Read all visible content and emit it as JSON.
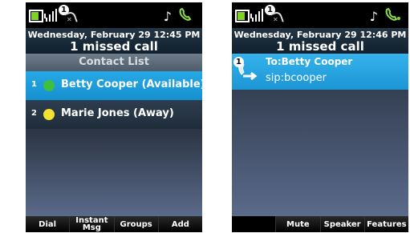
{
  "status_bar": {
    "notification_count": "1",
    "icons": [
      "battery-icon",
      "signal-icon",
      "missed-call-icon",
      "music-note-icon",
      "handset-icon"
    ]
  },
  "left_screen": {
    "date_line": "Wednesday, February 29 12:45 PM",
    "missed_line": "1 missed call",
    "list_title": "Contact List",
    "contacts": [
      {
        "index": "1",
        "name": "Betty Cooper (Available)",
        "status_color": "#3fbf3f"
      },
      {
        "index": "2",
        "name": "Marie Jones (Away)",
        "status_color": "#f2e033"
      }
    ],
    "softkeys": [
      "Dial",
      "Instant Msg",
      "Groups",
      "Add"
    ]
  },
  "right_screen": {
    "date_line": "Wednesday, February 29 12:46 PM",
    "missed_line": "1 missed call",
    "call": {
      "line_number": "1",
      "to_label": "To:Betty Cooper",
      "sip": "sip:bcooper"
    },
    "softkeys": [
      "",
      "Mute",
      "Speaker",
      "Features"
    ]
  },
  "colors": {
    "selected_row": "#1fa0e0",
    "battery_fill": "#7ed321",
    "accent_green": "#8fdc4a"
  }
}
